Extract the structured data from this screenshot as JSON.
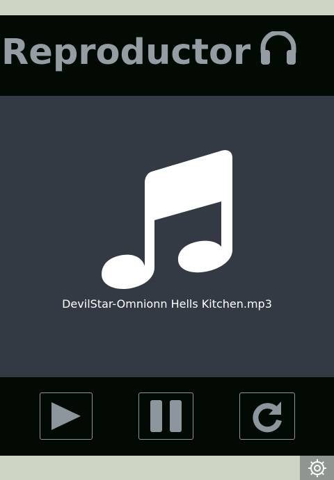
{
  "header": {
    "title": "Reproductor",
    "icon": "headphones-icon"
  },
  "player": {
    "icon": "music-note-icon",
    "track_name": "DevilStar-Omnionn Hells Kitchen.mp3"
  },
  "controls": {
    "play_icon": "play-icon",
    "pause_icon": "pause-icon",
    "repeat_icon": "repeat-icon"
  },
  "corner": {
    "icon": "settings-gear-icon"
  },
  "colors": {
    "background": "#cdd6c4",
    "header_bg": "#030a03",
    "player_bg": "#343a43",
    "title": "#959ca3",
    "icon_gray": "#8e969d",
    "white": "#ffffff"
  }
}
